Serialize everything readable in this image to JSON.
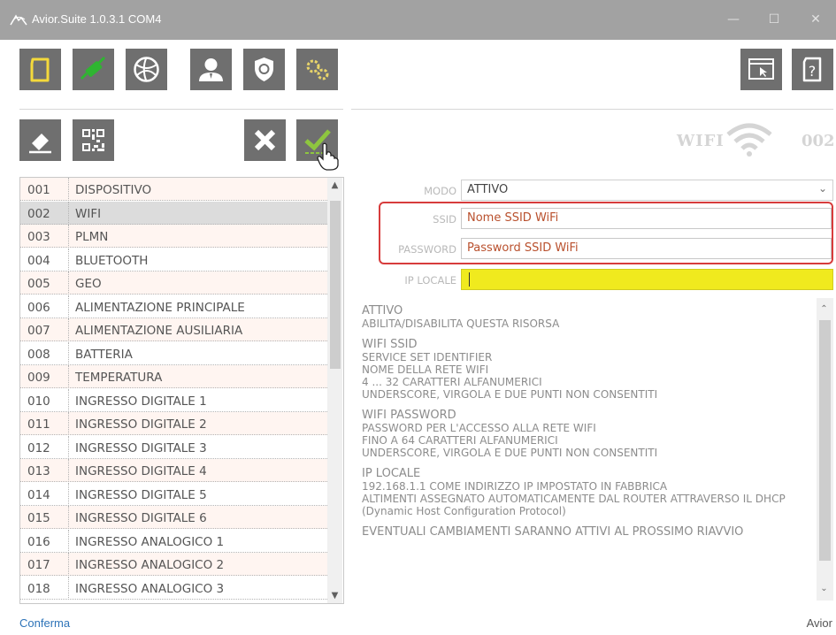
{
  "window": {
    "title": "Avior.Suite 1.0.3.1  COM4",
    "minimize": "—",
    "maximize": "☐",
    "close": "✕"
  },
  "toolbar": {
    "buttons": [
      "new-icon",
      "usb-icon",
      "network-icon",
      "user-icon",
      "shield-icon",
      "gears-icon"
    ],
    "right_buttons": [
      "window-cursor-icon",
      "help-icon"
    ]
  },
  "actions": [
    "eraser-icon",
    "qrcode-icon",
    "cancel-icon",
    "confirm-icon"
  ],
  "section": {
    "name": "WIFI",
    "number": "002"
  },
  "list": {
    "items": [
      {
        "num": "001",
        "label": "DISPOSITIVO"
      },
      {
        "num": "002",
        "label": "WIFI"
      },
      {
        "num": "003",
        "label": "PLMN"
      },
      {
        "num": "004",
        "label": "BLUETOOTH"
      },
      {
        "num": "005",
        "label": "GEO"
      },
      {
        "num": "006",
        "label": "ALIMENTAZIONE PRINCIPALE"
      },
      {
        "num": "007",
        "label": "ALIMENTAZIONE AUSILIARIA"
      },
      {
        "num": "008",
        "label": "BATTERIA"
      },
      {
        "num": "009",
        "label": "TEMPERATURA"
      },
      {
        "num": "010",
        "label": "INGRESSO DIGITALE 1"
      },
      {
        "num": "011",
        "label": "INGRESSO DIGITALE 2"
      },
      {
        "num": "012",
        "label": "INGRESSO DIGITALE 3"
      },
      {
        "num": "013",
        "label": "INGRESSO DIGITALE 4"
      },
      {
        "num": "014",
        "label": "INGRESSO DIGITALE 5"
      },
      {
        "num": "015",
        "label": "INGRESSO DIGITALE 6"
      },
      {
        "num": "016",
        "label": "INGRESSO ANALOGICO 1"
      },
      {
        "num": "017",
        "label": "INGRESSO ANALOGICO 2"
      },
      {
        "num": "018",
        "label": "INGRESSO ANALOGICO 3"
      }
    ],
    "selected": "002"
  },
  "form": {
    "modo_label": "MODO",
    "modo_value": "ATTIVO",
    "ssid_label": "SSID",
    "ssid_value": "Nome SSID WiFi",
    "password_label": "PASSWORD",
    "password_value": "Password SSID WiFi",
    "ip_label": "IP LOCALE",
    "ip_value": ""
  },
  "description": {
    "blocks": [
      {
        "title": "ATTIVO",
        "lines": [
          "ABILITA/DISABILITA QUESTA RISORSA"
        ]
      },
      {
        "title": "WIFI SSID",
        "lines": [
          "SERVICE SET IDENTIFIER",
          "NOME DELLA RETE WIFI",
          "4 ... 32 CARATTERI ALFANUMERICI",
          "UNDERSCORE, VIRGOLA E DUE PUNTI NON CONSENTITI"
        ]
      },
      {
        "title": "WIFI PASSWORD",
        "lines": [
          "PASSWORD PER L'ACCESSO ALLA RETE WIFI",
          "FINO A 64 CARATTERI ALFANUMERICI",
          "UNDERSCORE, VIRGOLA E DUE PUNTI NON CONSENTITI"
        ]
      },
      {
        "title": "IP LOCALE",
        "lines": [
          "192.168.1.1 COME INDIRIZZO IP IMPOSTATO IN FABBRICA",
          "ALTIMENTI ASSEGNATO AUTOMATICAMENTE DAL ROUTER ATTRAVERSO IL DHCP",
          "(Dynamic Host Configuration Protocol)"
        ]
      },
      {
        "title": "EVENTUALI CAMBIAMENTI SARANNO ATTIVI AL PROSSIMO RIAVVIO",
        "lines": []
      }
    ]
  },
  "status": {
    "left": "Conferma",
    "right": "Avior"
  },
  "colors": {
    "titlebar": "#a2a2a2",
    "button_bg": "#6f6f6f",
    "yellow_field": "#f0ea1e",
    "highlight": "#d73c3c",
    "status_link": "#2d73b8"
  }
}
